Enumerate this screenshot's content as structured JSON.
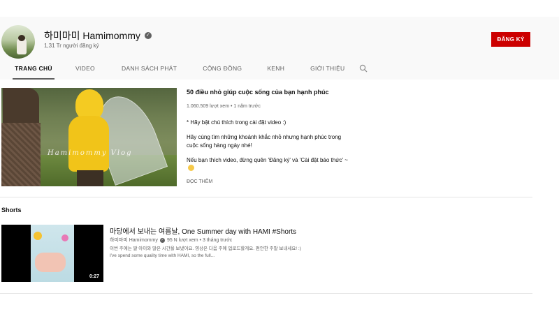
{
  "channel": {
    "name": "하미마미 Hamimommy",
    "subscribers": "1,31 Tr người đăng ký",
    "subscribe_label": "ĐĂNG KÝ"
  },
  "tabs": [
    {
      "label": "TRANG CHỦ",
      "active": true
    },
    {
      "label": "VIDEO",
      "active": false
    },
    {
      "label": "DANH SÁCH PHÁT",
      "active": false
    },
    {
      "label": "CỘNG ĐỒNG",
      "active": false
    },
    {
      "label": "KENH",
      "active": false
    },
    {
      "label": "GIỚI THIỆU",
      "active": false
    }
  ],
  "featured": {
    "title": "50 điều nhỏ giúp cuộc sống của bạn hạnh phúc",
    "meta": "1.060.509 lượt xem • 1 năm trước",
    "thumbnail_text": "Hamimommy Vlog",
    "desc1": "* Hãy bật chú thích trong cài đặt video :)",
    "desc2": "Hãy cùng tìm những khoảnh khắc nhỏ nhưng hạnh phúc trong cuộc sống hàng ngày nhé!",
    "desc3": "Nếu bạn thích video, đừng quên 'Đăng ký' và 'Cài đặt báo thức' ~",
    "read_more": "ĐỌC THÊM"
  },
  "shorts": {
    "heading": "Shorts",
    "item": {
      "title": "마당에서 보내는 여름날, One Summer day with HAMI #Shorts",
      "channel": "하미마미 Hamimommy",
      "stats": "95 N lượt xem • 3 tháng trước",
      "desc_ko": "이번 주에는 딸 아이와 많은 시간을 보냈어요. 영상은 다음 주에 업로드할게요. 편안한 주말 보내세요! :)",
      "desc_en": "I've spend some quality time with HAMI, so the full...",
      "duration": "0:27"
    }
  },
  "colors": {
    "subscribe": "#cc0000",
    "header_bg": "#f9f9f9",
    "secondary_text": "#606060"
  }
}
